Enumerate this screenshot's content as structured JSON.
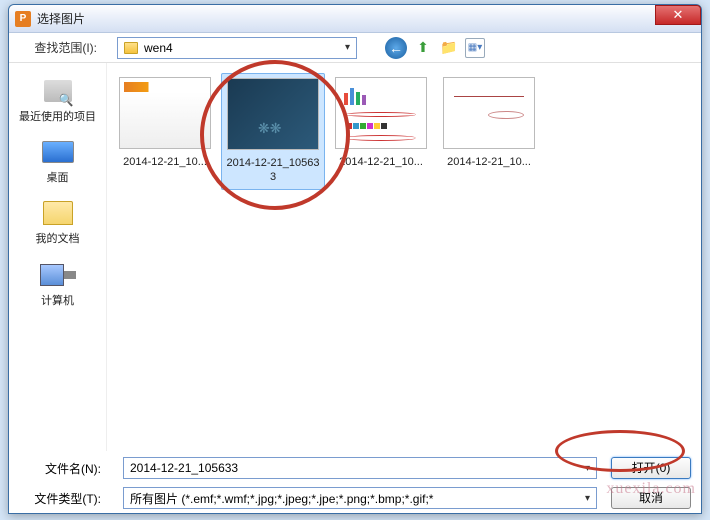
{
  "window": {
    "title": "选择图片",
    "icon_letter": "P"
  },
  "toolbar": {
    "lookin_label": "查找范围(I):",
    "folder_name": "wen4"
  },
  "sidebar": {
    "items": [
      {
        "label": "最近使用的项目"
      },
      {
        "label": "桌面"
      },
      {
        "label": "我的文档"
      },
      {
        "label": "计算机"
      }
    ]
  },
  "files": {
    "items": [
      {
        "label": "2014-12-21_10...",
        "selected": false
      },
      {
        "label": "2014-12-21_105633",
        "selected": true
      },
      {
        "label": "2014-12-21_10...",
        "selected": false
      },
      {
        "label": "2014-12-21_10...",
        "selected": false
      }
    ]
  },
  "footer": {
    "filename_label": "文件名(N):",
    "filename_value": "2014-12-21_105633",
    "filetype_label": "文件类型(T):",
    "filetype_value": "所有图片 (*.emf;*.wmf;*.jpg;*.jpeg;*.jpe;*.png;*.bmp;*.gif;*",
    "open_btn": "打开(0)",
    "cancel_btn": "取消"
  },
  "watermark": "xuexila.com"
}
